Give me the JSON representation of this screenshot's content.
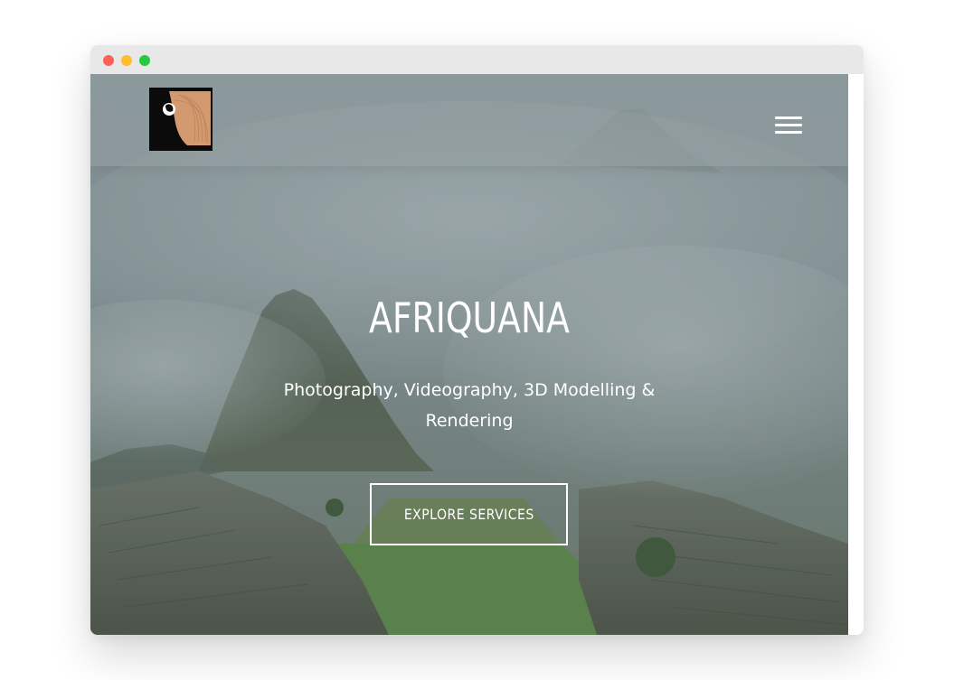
{
  "window": {
    "controls": [
      "close",
      "minimize",
      "maximize"
    ],
    "colors": {
      "close": "#fe5f57",
      "minimize": "#febc2e",
      "maximize": "#28c840"
    }
  },
  "nav": {
    "logo_icon": "afriquana-logo",
    "menu_icon": "hamburger-menu-icon"
  },
  "hero": {
    "title": "AFRIQUANA",
    "subtitle": "Photography, Videography, 3D Modelling & Rendering",
    "cta_label": "EXPLORE SERVICES",
    "background": "misty-mountain-ruins-photo"
  },
  "colors": {
    "text": "#ffffff",
    "logo_accent": "#d39a70",
    "navbar_tint": "#96a0a3"
  }
}
